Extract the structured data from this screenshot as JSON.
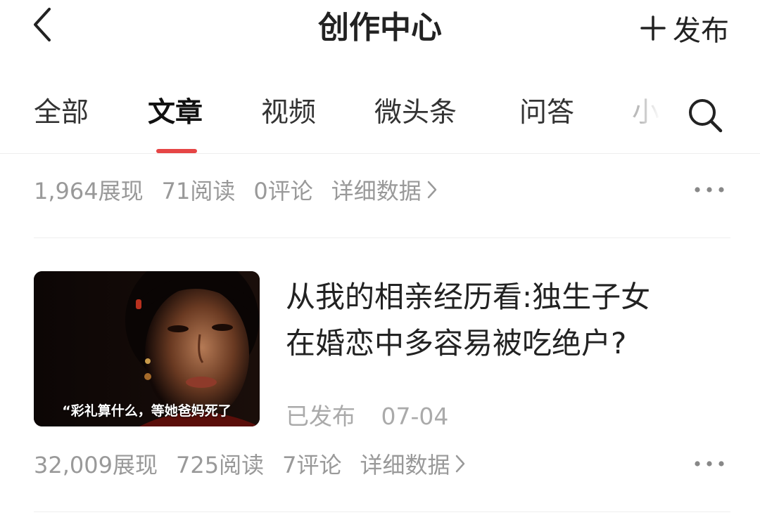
{
  "header": {
    "title": "创作中心",
    "publish_label": "发布",
    "back_icon": "chevron-left-icon",
    "publish_icon": "plus-icon"
  },
  "tabs": {
    "items": [
      {
        "label": "全部",
        "active": false
      },
      {
        "label": "文章",
        "active": true
      },
      {
        "label": "视频",
        "active": false
      },
      {
        "label": "微头条",
        "active": false
      },
      {
        "label": "问答",
        "active": false
      }
    ],
    "overflow_label": "小",
    "search_icon": "search-icon",
    "indicator_color": "#e64545"
  },
  "stats_top": {
    "impressions": "1,964展现",
    "reads": "71阅读",
    "comments": "0评论",
    "detail_label": "详细数据"
  },
  "article": {
    "thumbnail_caption": "“彩礼算什么，等她爸妈死了",
    "title_line1": "从我的相亲经历看:独生子女",
    "title_line2": "在婚恋中多容易被吃绝户?",
    "status": "已发布",
    "date": "07-04"
  },
  "stats_article": {
    "impressions": "32,009展现",
    "reads": "725阅读",
    "comments": "7评论",
    "detail_label": "详细数据"
  },
  "colors": {
    "text_primary": "#222222",
    "text_secondary": "#999999",
    "accent": "#e64545",
    "divider": "#eeeeee"
  }
}
